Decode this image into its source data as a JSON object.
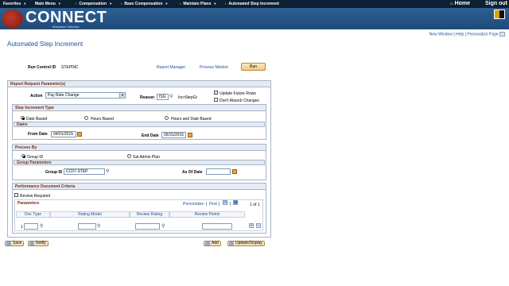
{
  "nav": {
    "items": [
      "Favorites",
      "Main Menu",
      "Compensation",
      "Base Compensation",
      "Maintain Plans",
      "Automated Step Increment"
    ],
    "home": "Home",
    "signout": "Sign out"
  },
  "brand": {
    "name": "CONNECT",
    "sub": "Maryland Judiciary"
  },
  "util": {
    "new_window": "New Window",
    "help": "Help",
    "personalize": "Personalize Page"
  },
  "page_title": "Automated Step Increment",
  "run": {
    "control_label": "Run Control ID",
    "control_value": "STEPINC",
    "report_manager": "Report Manager",
    "process_monitor": "Process Monitor",
    "run_button": "Run"
  },
  "report": {
    "header": "Report Request Parameter(s)",
    "action_label": "Action",
    "action_value": "Pay Rate Change",
    "reason_label": "Reason",
    "reason_value": "ISG",
    "reason_desc": "IncrStepGr",
    "update_future": "Update Future Rows",
    "dont_absorb": "Don't Absorb Changes"
  },
  "step_type": {
    "header": "Step Increment Type",
    "opt1": "Date Based",
    "opt2": "Hours Based",
    "opt3": "Hours and Date Based",
    "dates_header": "Dates",
    "from_label": "From Date",
    "from_value": "04/01/2015",
    "end_label": "End Date",
    "end_value": "05/31/2015"
  },
  "process_by": {
    "header": "Process By",
    "opt1": "Group ID",
    "opt2": "Sal Admin Plan",
    "group_header": "Group Parameters",
    "group_label": "Group ID",
    "group_value": "CC07-STEP",
    "asof_label": "As Of Date",
    "asof_value": ""
  },
  "perf": {
    "header": "Performance Document Criteria",
    "review_required": "Review Required",
    "params_header": "Parameters",
    "personalize": "Personalize",
    "find": "Find",
    "count": "1 of 1",
    "columns": [
      "Doc Type",
      "Rating Model",
      "Review Rating",
      "Review Points"
    ],
    "row_num": "1"
  },
  "bottom": {
    "save": "Save",
    "notify": "Notify",
    "add": "Add",
    "update_display": "Update/Display"
  }
}
